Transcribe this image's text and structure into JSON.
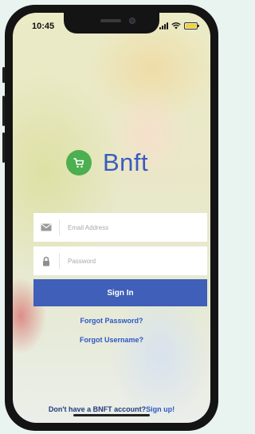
{
  "status_bar": {
    "time": "10:45"
  },
  "brand": {
    "name": "Bnft",
    "logo_color": "#4caf50",
    "brand_color": "#3b5bbf"
  },
  "login": {
    "email_placeholder": "Email Address",
    "password_placeholder": "Password",
    "signin_label": "Sign In",
    "forgot_password": "Forgot Password?",
    "forgot_username": "Forgot Username?",
    "signup_prompt": "Don't have a BNFT account?",
    "signup_link": "Sign up!",
    "button_color": "#3f5fb8",
    "link_color": "#2f57c2"
  },
  "icons": [
    "cart-icon",
    "mail-icon",
    "lock-icon",
    "signal-icon",
    "wifi-icon",
    "battery-icon"
  ]
}
